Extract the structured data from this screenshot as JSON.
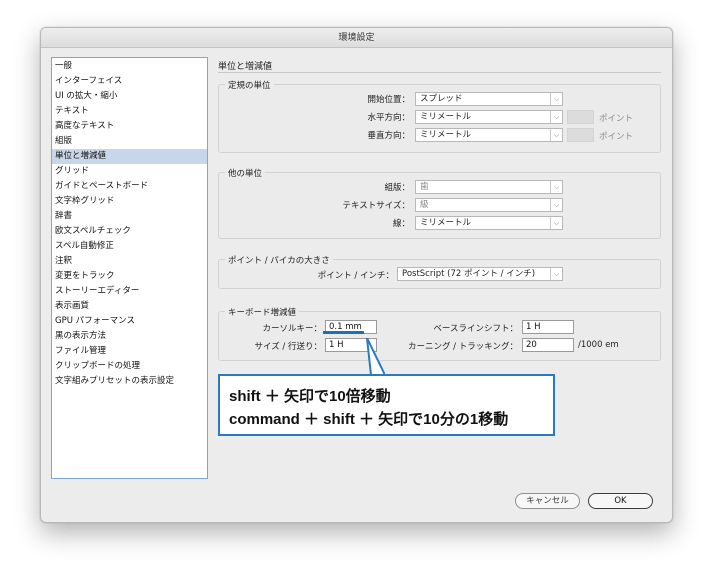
{
  "window": {
    "title": "環境設定"
  },
  "sidebar": {
    "items": [
      "一般",
      "インターフェイス",
      "UI の拡大・縮小",
      "テキスト",
      "高度なテキスト",
      "組版",
      "単位と増減値",
      "グリッド",
      "ガイドとペーストボード",
      "文字枠グリッド",
      "辞書",
      "欧文スペルチェック",
      "スペル自動修正",
      "注釈",
      "変更をトラック",
      "ストーリーエディター",
      "表示画質",
      "GPU パフォーマンス",
      "黒の表示方法",
      "ファイル管理",
      "クリップボードの処理",
      "文字組みプリセットの表示設定"
    ],
    "selected": "単位と増減値"
  },
  "panel": {
    "title": "単位と増減値",
    "ruler_units": {
      "title": "定規の単位",
      "origin_label": "開始位置：",
      "origin_value": "スプレッド",
      "horizontal_label": "水平方向：",
      "horizontal_value": "ミリメートル",
      "horizontal_unit": "ポイント",
      "vertical_label": "垂直方向：",
      "vertical_value": "ミリメートル",
      "vertical_unit": "ポイント"
    },
    "other_units": {
      "title": "他の単位",
      "composition_label": "組版：",
      "composition_value": "歯",
      "text_size_label": "テキストサイズ：",
      "text_size_value": "級",
      "stroke_label": "線：",
      "stroke_value": "ミリメートル"
    },
    "point_pica": {
      "title": "ポイント / パイカの大きさ",
      "label": "ポイント / インチ：",
      "value": "PostScript (72 ポイント / インチ)"
    },
    "keyboard": {
      "title": "キーボード増減値",
      "cursor_label": "カーソルキー：",
      "cursor_value": "0.1 mm",
      "size_leading_label": "サイズ / 行送り：",
      "size_leading_value": "1 H",
      "baseline_label": "ベースラインシフト：",
      "baseline_value": "1 H",
      "kerning_label": "カーニング / トラッキング：",
      "kerning_value": "20",
      "kerning_unit": "/1000 em"
    }
  },
  "buttons": {
    "cancel": "キャンセル",
    "ok": "OK"
  },
  "callout": {
    "line1": "shift ＋ 矢印で10倍移動",
    "line2": "command ＋ shift ＋ 矢印で10分の1移動"
  },
  "colors": {
    "accent": "#2a7ac0",
    "selection": "#c8d6ea"
  }
}
